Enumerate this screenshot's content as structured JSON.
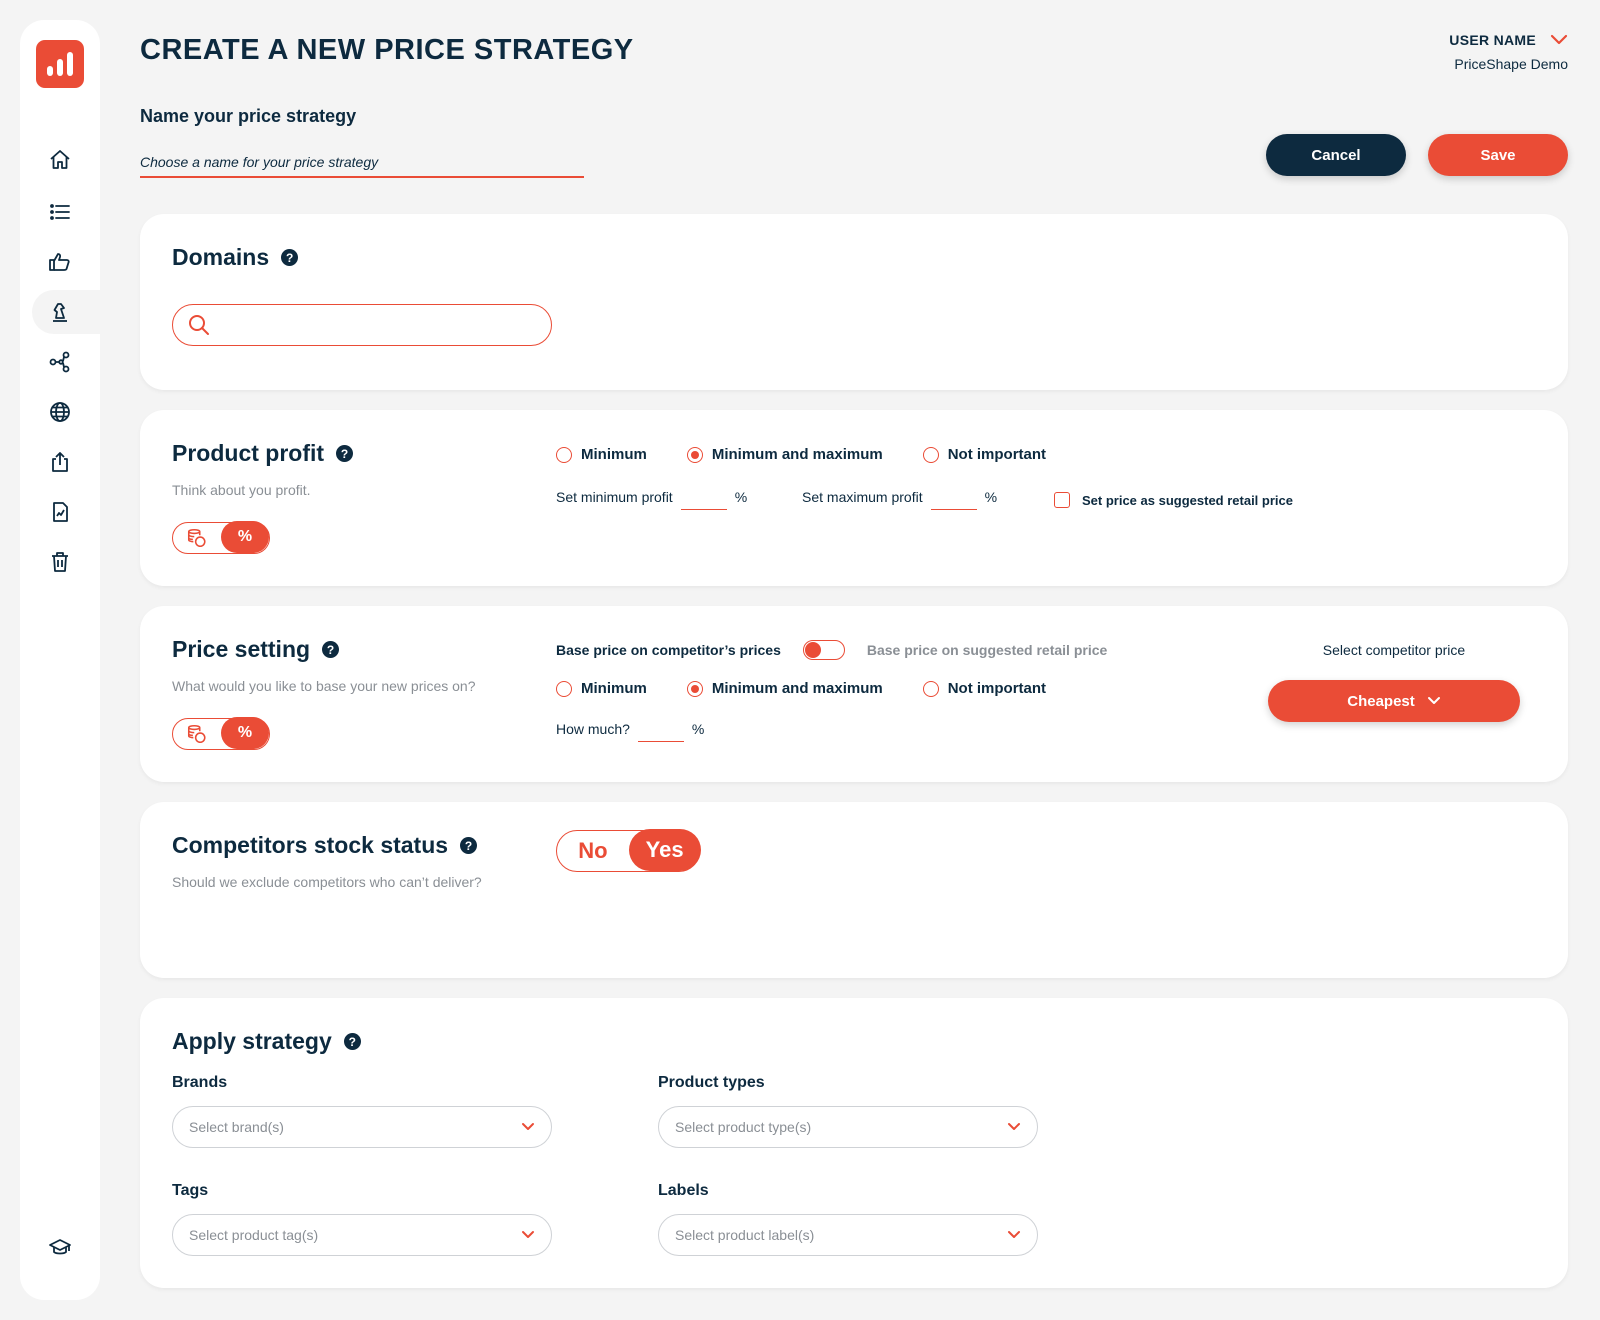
{
  "header": {
    "title": "CREATE A NEW PRICE STRATEGY",
    "user_name": "USER NAME",
    "user_company": "PriceShape Demo",
    "name_label": "Name your price strategy",
    "name_placeholder": "Choose a name for your price strategy",
    "cancel_label": "Cancel",
    "save_label": "Save"
  },
  "sidebar": {
    "items": [
      {
        "icon": "home-icon"
      },
      {
        "icon": "list-icon"
      },
      {
        "icon": "thumbs-up-icon"
      },
      {
        "icon": "chess-knight-icon",
        "active": true
      },
      {
        "icon": "share-nodes-icon"
      },
      {
        "icon": "globe-icon"
      },
      {
        "icon": "export-icon"
      },
      {
        "icon": "report-icon"
      },
      {
        "icon": "trash-icon"
      },
      {
        "icon": "graduation-cap-icon"
      }
    ]
  },
  "domains": {
    "title": "Domains",
    "help": "?",
    "search_value": ""
  },
  "profit": {
    "title": "Product profit",
    "help": "?",
    "subtitle": "Think about you profit.",
    "unit_pct": "%",
    "options": [
      "Minimum",
      "Minimum and maximum",
      "Not important"
    ],
    "selected": "Minimum and maximum",
    "min_label": "Set minimum profit",
    "max_label": "Set maximum profit",
    "unit": "%",
    "srp_label": "Set price as suggested retail price"
  },
  "price_setting": {
    "title": "Price setting",
    "help": "?",
    "subtitle": "What would you like to base your new prices on?",
    "unit_pct": "%",
    "base_competitor": "Base price on competitor’s prices",
    "base_srp": "Base price on suggested retail price",
    "options": [
      "Minimum",
      "Minimum and maximum",
      "Not important"
    ],
    "selected": "Minimum and maximum",
    "how_much_label": "How much?",
    "unit": "%",
    "competitor_label": "Select competitor price",
    "competitor_value": "Cheapest"
  },
  "stock": {
    "title": "Competitors stock status",
    "help": "?",
    "subtitle": "Should we exclude competitors who can’t deliver?",
    "no": "No",
    "yes": "Yes",
    "selected": "Yes"
  },
  "apply": {
    "title": "Apply strategy",
    "help": "?",
    "brands_label": "Brands",
    "brands_placeholder": "Select brand(s)",
    "types_label": "Product types",
    "types_placeholder": "Select product type(s)",
    "tags_label": "Tags",
    "tags_placeholder": "Select product tag(s)",
    "labels_label": "Labels",
    "labels_placeholder": "Select product label(s)"
  },
  "colors": {
    "accent": "#ea4c36",
    "navy": "#0d2a3f",
    "background": "#f4f4f4"
  }
}
